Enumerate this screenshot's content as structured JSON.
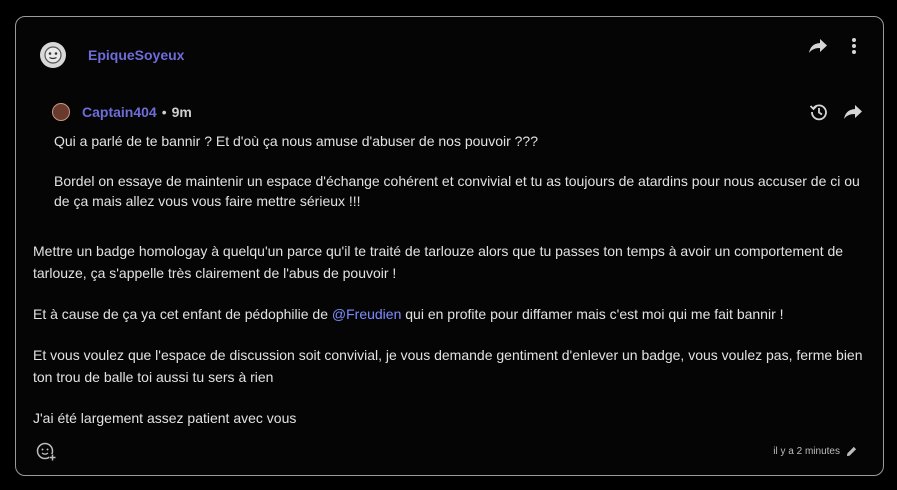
{
  "post": {
    "author": "EpiqueSoyeux",
    "quote": {
      "author": "Captain404",
      "separator": "•",
      "time": "9m",
      "lines": [
        "Qui a parlé de te bannir ? Et d'où ça nous amuse d'abuser de nos pouvoir ???",
        "Bordel on essaye de maintenir un espace d'échange cohérent et convivial et tu as toujours de atardins pour nous accuser de ci ou de ça mais allez vous vous faire mettre sérieux !!!"
      ]
    },
    "paragraph1": "Mettre un badge homologay à quelqu'un parce qu'il te traité de tarlouze alors que tu passes ton temps à avoir un comportement de tarlouze, ça s'appelle très clairement de l'abus de pouvoir !",
    "paragraph2_before": "Et à cause de ça ya cet enfant de pédophilie de ",
    "mention": "@Freudien",
    "paragraph2_after": " qui en profite pour diffamer mais c'est moi qui me fait bannir !",
    "paragraph3": "Et vous voulez que l'espace de discussion soit convivial, je vous demande gentiment d'enlever un badge, vous voulez pas, ferme bien ton trou de balle toi aussi tu sers à rien",
    "paragraph4": "J'ai été largement assez patient avec vous",
    "timestamp": "il y a 2 minutes"
  },
  "icons": {
    "share": "share-arrow-icon",
    "more": "more-vertical-icon",
    "history": "history-icon",
    "reaction": "add-reaction-icon",
    "edit": "pencil-icon"
  },
  "colors": {
    "accent": "#6e6cd8",
    "mention": "#7f8cff",
    "border": "#9a9a9a",
    "background": "#000000"
  }
}
